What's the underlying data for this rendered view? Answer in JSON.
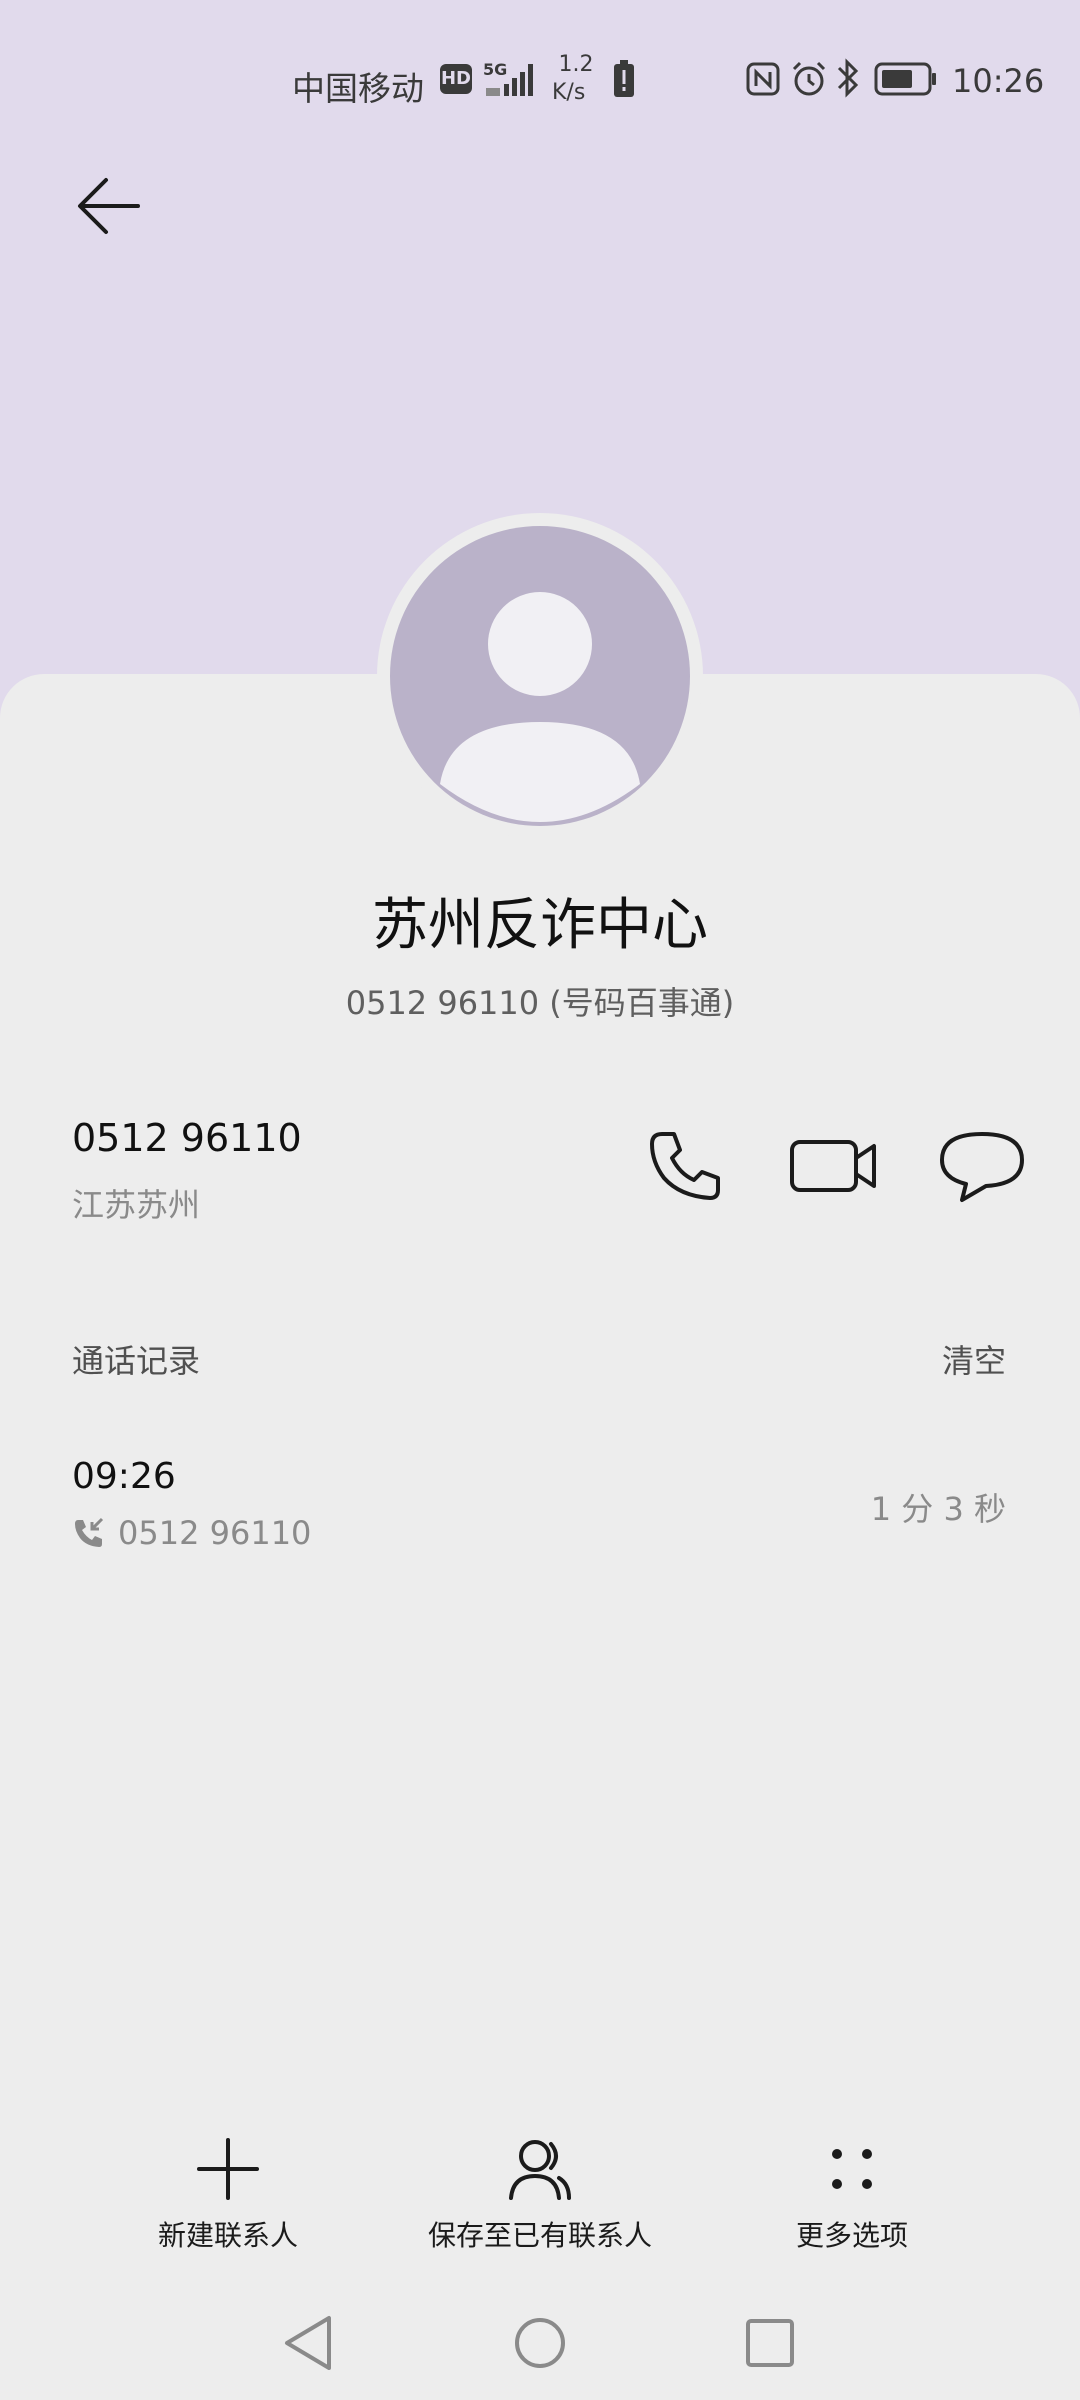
{
  "status_bar": {
    "carrier": "中国移动",
    "hd": "HD",
    "network": "5G",
    "speed_value": "1.2",
    "speed_unit": "K/s",
    "time": "10:26"
  },
  "contact": {
    "name": "苏州反诈中心",
    "subtitle": "0512 96110 (号码百事通)",
    "number": "0512 96110",
    "location": "江苏苏州"
  },
  "call_log": {
    "title": "通话记录",
    "clear_label": "清空",
    "records": [
      {
        "time": "09:26",
        "number": "0512 96110",
        "duration": "1 分 3 秒"
      }
    ]
  },
  "toolbar": {
    "new_contact": "新建联系人",
    "save_existing": "保存至已有联系人",
    "more_options": "更多选项"
  },
  "colors": {
    "header_bg": "#E1DAEC",
    "card_bg": "#EDEDED",
    "avatar_bg": "#BAB2C9"
  }
}
